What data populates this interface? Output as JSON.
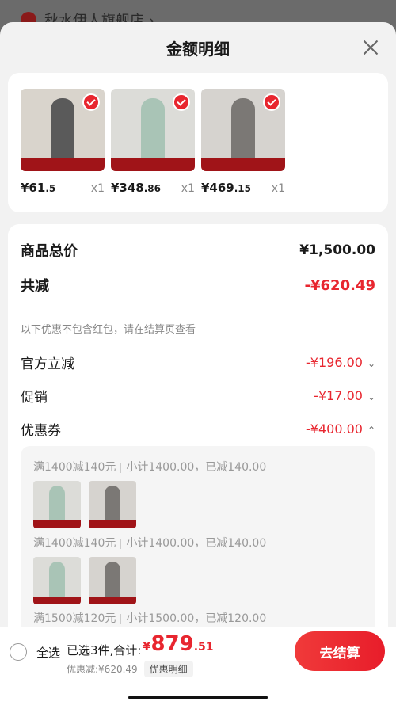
{
  "under_header": {
    "shop_name": "秋水伊人旗舰店 ›"
  },
  "sheet": {
    "title": "金额明细"
  },
  "products": [
    {
      "price_int": "¥61",
      "price_dec": ".5",
      "qty": "x1",
      "image": "plaid-skirt-product",
      "bg": "#d9d4cc",
      "figure": "#5a5a5a"
    },
    {
      "price_int": "¥348",
      "price_dec": ".86",
      "qty": "x1",
      "image": "green-hoodie-product",
      "bg": "#dcdcd8",
      "figure": "#a9c4b6"
    },
    {
      "price_int": "¥469",
      "price_dec": ".15",
      "qty": "x1",
      "image": "grey-coat-product",
      "bg": "#d6d3cf",
      "figure": "#7b7875"
    }
  ],
  "summary": {
    "total_label": "商品总价",
    "total_value": "¥1,500.00",
    "reduce_label": "共减",
    "reduce_value": "-¥620.49",
    "note": "以下优惠不包含红包，请在结算页查看",
    "official_label": "官方立减",
    "official_value": "-¥196.00",
    "promo_label": "促销",
    "promo_value": "-¥17.00",
    "coupon_label": "优惠券",
    "coupon_value": "-¥400.00"
  },
  "coupons": [
    {
      "rule": "满1400减140元",
      "detail": "小计1400.00，已减140.00"
    },
    {
      "rule": "满1400减140元",
      "detail": "小计1400.00，已减140.00"
    },
    {
      "rule": "满1500减120元",
      "detail": "小计1500.00，已减120.00"
    }
  ],
  "bottom": {
    "select_all": "全选",
    "selected_count": "已选3件,合计:",
    "currency": "¥",
    "total_int": "879",
    "total_dec": ".51",
    "discount_text": "优惠减:¥620.49",
    "detail_tag": "优惠明细",
    "checkout": "去结算"
  },
  "colors": {
    "accent": "#e8262f",
    "band": "#a01418"
  }
}
